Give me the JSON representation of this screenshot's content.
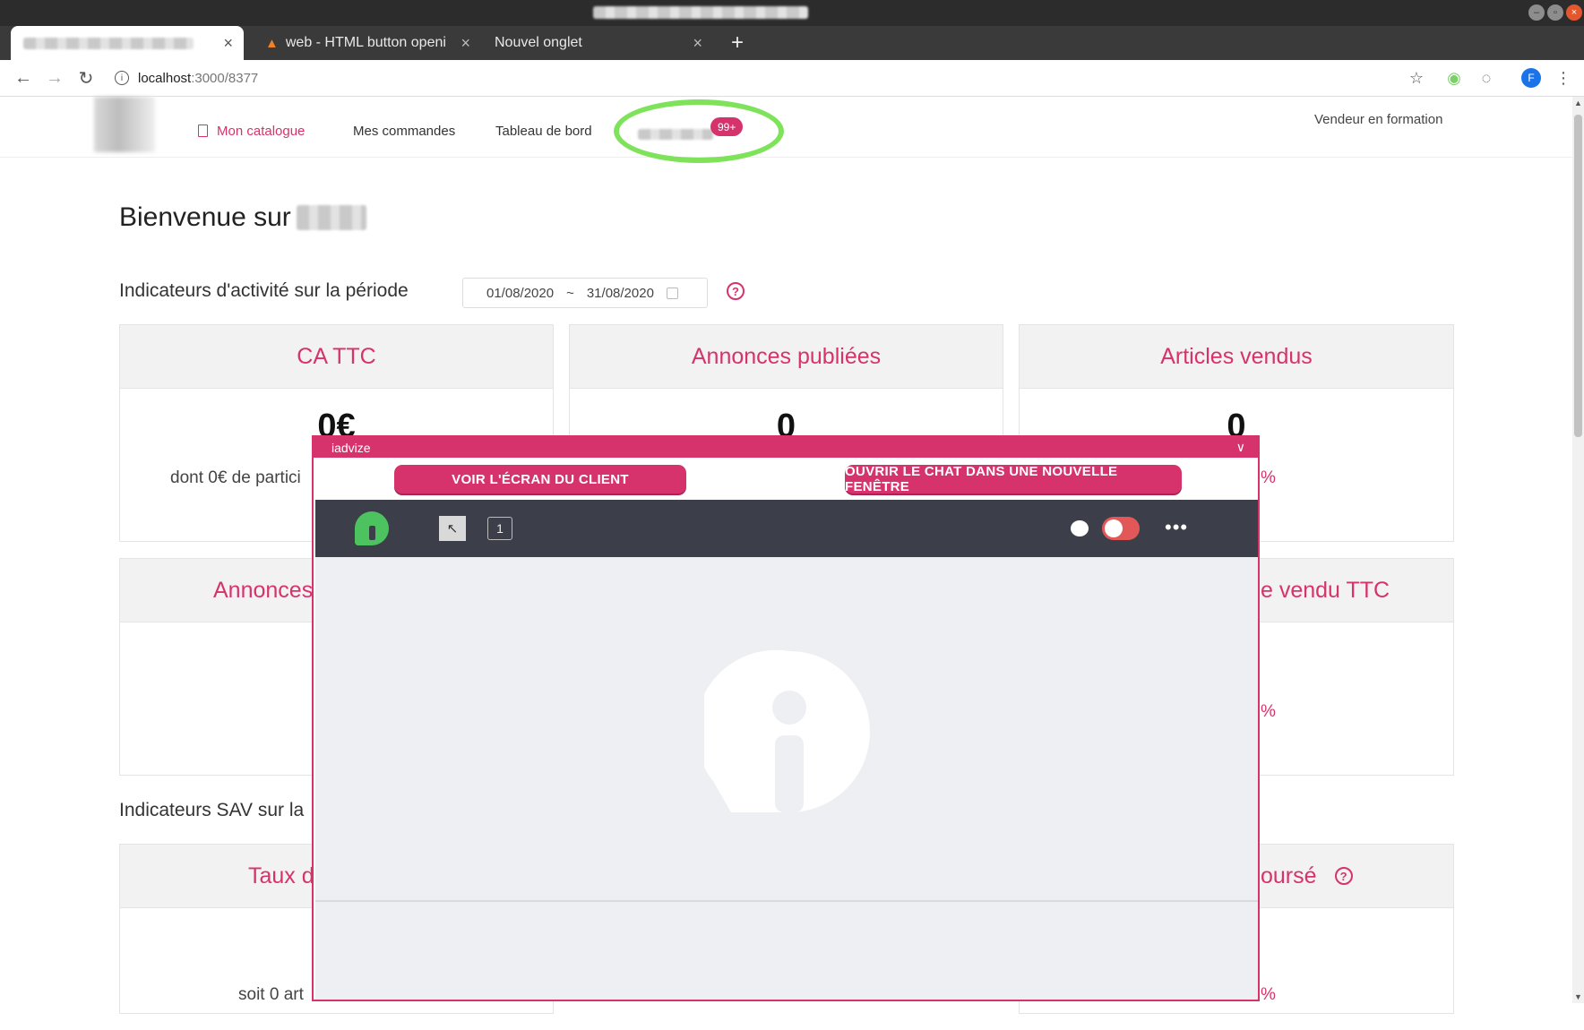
{
  "browser": {
    "tabs": [
      {
        "title": "",
        "active": true
      },
      {
        "title": "web - HTML button openi",
        "active": false
      },
      {
        "title": "Nouvel onglet",
        "active": false
      }
    ],
    "new_tab": "+",
    "url_host": "localhost",
    "url_path": ":3000/8377",
    "profile_initial": "F"
  },
  "header": {
    "nav": {
      "catalogue": "Mon catalogue",
      "commandes": "Mes commandes",
      "tableau": "Tableau de bord",
      "badge": "99+"
    },
    "seller_status": "Vendeur en formation"
  },
  "main": {
    "welcome": "Bienvenue sur",
    "activity_title": "Indicateurs d'activité sur la période",
    "date_start": "01/08/2020",
    "date_sep": "~",
    "date_end": "31/08/2020",
    "help": "?",
    "cards": {
      "ca": {
        "title": "CA TTC",
        "value": "0€",
        "sub": "dont 0€ de partici"
      },
      "annonces": {
        "title": "Annonces publiées",
        "value": "0"
      },
      "articles": {
        "title": "Articles vendus",
        "value": "0",
        "pct": "%"
      },
      "annonces2": {
        "title": "Annonces"
      },
      "vendu": {
        "title": "e vendu TTC",
        "pct": "%"
      },
      "taux": {
        "title": "Taux d",
        "sub": "soit 0 art"
      },
      "rembourse": {
        "title": "oursé",
        "pct": "%"
      }
    },
    "sav_title": "Indicateurs SAV sur la"
  },
  "iadvize": {
    "title": "iadvize",
    "btn_client": "VOIR L'ÉCRAN DU CLIENT",
    "btn_chat": "OUVRIR LE CHAT DANS UNE NOUVELLE FENÊTRE",
    "count": "1",
    "more": "•••"
  },
  "colors": {
    "accent": "#d6336c",
    "highlight": "#7ee35a",
    "iadvize_bar": "#3c3f4a",
    "iadvize_green": "#4cc35e"
  }
}
